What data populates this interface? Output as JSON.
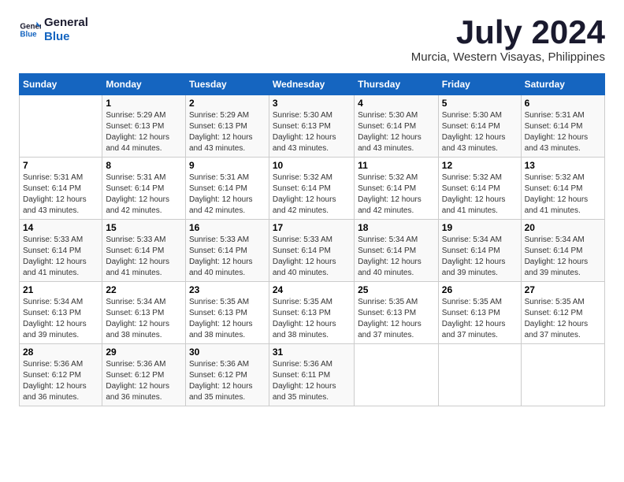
{
  "app": {
    "logo_line1": "General",
    "logo_line2": "Blue"
  },
  "header": {
    "month_year": "July 2024",
    "location": "Murcia, Western Visayas, Philippines"
  },
  "days_of_week": [
    "Sunday",
    "Monday",
    "Tuesday",
    "Wednesday",
    "Thursday",
    "Friday",
    "Saturday"
  ],
  "weeks": [
    [
      {
        "day": "",
        "sunrise": "",
        "sunset": "",
        "daylight": ""
      },
      {
        "day": "1",
        "sunrise": "Sunrise: 5:29 AM",
        "sunset": "Sunset: 6:13 PM",
        "daylight": "Daylight: 12 hours and 44 minutes."
      },
      {
        "day": "2",
        "sunrise": "Sunrise: 5:29 AM",
        "sunset": "Sunset: 6:13 PM",
        "daylight": "Daylight: 12 hours and 43 minutes."
      },
      {
        "day": "3",
        "sunrise": "Sunrise: 5:30 AM",
        "sunset": "Sunset: 6:13 PM",
        "daylight": "Daylight: 12 hours and 43 minutes."
      },
      {
        "day": "4",
        "sunrise": "Sunrise: 5:30 AM",
        "sunset": "Sunset: 6:14 PM",
        "daylight": "Daylight: 12 hours and 43 minutes."
      },
      {
        "day": "5",
        "sunrise": "Sunrise: 5:30 AM",
        "sunset": "Sunset: 6:14 PM",
        "daylight": "Daylight: 12 hours and 43 minutes."
      },
      {
        "day": "6",
        "sunrise": "Sunrise: 5:31 AM",
        "sunset": "Sunset: 6:14 PM",
        "daylight": "Daylight: 12 hours and 43 minutes."
      }
    ],
    [
      {
        "day": "7",
        "sunrise": "Sunrise: 5:31 AM",
        "sunset": "Sunset: 6:14 PM",
        "daylight": "Daylight: 12 hours and 43 minutes."
      },
      {
        "day": "8",
        "sunrise": "Sunrise: 5:31 AM",
        "sunset": "Sunset: 6:14 PM",
        "daylight": "Daylight: 12 hours and 42 minutes."
      },
      {
        "day": "9",
        "sunrise": "Sunrise: 5:31 AM",
        "sunset": "Sunset: 6:14 PM",
        "daylight": "Daylight: 12 hours and 42 minutes."
      },
      {
        "day": "10",
        "sunrise": "Sunrise: 5:32 AM",
        "sunset": "Sunset: 6:14 PM",
        "daylight": "Daylight: 12 hours and 42 minutes."
      },
      {
        "day": "11",
        "sunrise": "Sunrise: 5:32 AM",
        "sunset": "Sunset: 6:14 PM",
        "daylight": "Daylight: 12 hours and 42 minutes."
      },
      {
        "day": "12",
        "sunrise": "Sunrise: 5:32 AM",
        "sunset": "Sunset: 6:14 PM",
        "daylight": "Daylight: 12 hours and 41 minutes."
      },
      {
        "day": "13",
        "sunrise": "Sunrise: 5:32 AM",
        "sunset": "Sunset: 6:14 PM",
        "daylight": "Daylight: 12 hours and 41 minutes."
      }
    ],
    [
      {
        "day": "14",
        "sunrise": "Sunrise: 5:33 AM",
        "sunset": "Sunset: 6:14 PM",
        "daylight": "Daylight: 12 hours and 41 minutes."
      },
      {
        "day": "15",
        "sunrise": "Sunrise: 5:33 AM",
        "sunset": "Sunset: 6:14 PM",
        "daylight": "Daylight: 12 hours and 41 minutes."
      },
      {
        "day": "16",
        "sunrise": "Sunrise: 5:33 AM",
        "sunset": "Sunset: 6:14 PM",
        "daylight": "Daylight: 12 hours and 40 minutes."
      },
      {
        "day": "17",
        "sunrise": "Sunrise: 5:33 AM",
        "sunset": "Sunset: 6:14 PM",
        "daylight": "Daylight: 12 hours and 40 minutes."
      },
      {
        "day": "18",
        "sunrise": "Sunrise: 5:34 AM",
        "sunset": "Sunset: 6:14 PM",
        "daylight": "Daylight: 12 hours and 40 minutes."
      },
      {
        "day": "19",
        "sunrise": "Sunrise: 5:34 AM",
        "sunset": "Sunset: 6:14 PM",
        "daylight": "Daylight: 12 hours and 39 minutes."
      },
      {
        "day": "20",
        "sunrise": "Sunrise: 5:34 AM",
        "sunset": "Sunset: 6:14 PM",
        "daylight": "Daylight: 12 hours and 39 minutes."
      }
    ],
    [
      {
        "day": "21",
        "sunrise": "Sunrise: 5:34 AM",
        "sunset": "Sunset: 6:13 PM",
        "daylight": "Daylight: 12 hours and 39 minutes."
      },
      {
        "day": "22",
        "sunrise": "Sunrise: 5:34 AM",
        "sunset": "Sunset: 6:13 PM",
        "daylight": "Daylight: 12 hours and 38 minutes."
      },
      {
        "day": "23",
        "sunrise": "Sunrise: 5:35 AM",
        "sunset": "Sunset: 6:13 PM",
        "daylight": "Daylight: 12 hours and 38 minutes."
      },
      {
        "day": "24",
        "sunrise": "Sunrise: 5:35 AM",
        "sunset": "Sunset: 6:13 PM",
        "daylight": "Daylight: 12 hours and 38 minutes."
      },
      {
        "day": "25",
        "sunrise": "Sunrise: 5:35 AM",
        "sunset": "Sunset: 6:13 PM",
        "daylight": "Daylight: 12 hours and 37 minutes."
      },
      {
        "day": "26",
        "sunrise": "Sunrise: 5:35 AM",
        "sunset": "Sunset: 6:13 PM",
        "daylight": "Daylight: 12 hours and 37 minutes."
      },
      {
        "day": "27",
        "sunrise": "Sunrise: 5:35 AM",
        "sunset": "Sunset: 6:12 PM",
        "daylight": "Daylight: 12 hours and 37 minutes."
      }
    ],
    [
      {
        "day": "28",
        "sunrise": "Sunrise: 5:36 AM",
        "sunset": "Sunset: 6:12 PM",
        "daylight": "Daylight: 12 hours and 36 minutes."
      },
      {
        "day": "29",
        "sunrise": "Sunrise: 5:36 AM",
        "sunset": "Sunset: 6:12 PM",
        "daylight": "Daylight: 12 hours and 36 minutes."
      },
      {
        "day": "30",
        "sunrise": "Sunrise: 5:36 AM",
        "sunset": "Sunset: 6:12 PM",
        "daylight": "Daylight: 12 hours and 35 minutes."
      },
      {
        "day": "31",
        "sunrise": "Sunrise: 5:36 AM",
        "sunset": "Sunset: 6:11 PM",
        "daylight": "Daylight: 12 hours and 35 minutes."
      },
      {
        "day": "",
        "sunrise": "",
        "sunset": "",
        "daylight": ""
      },
      {
        "day": "",
        "sunrise": "",
        "sunset": "",
        "daylight": ""
      },
      {
        "day": "",
        "sunrise": "",
        "sunset": "",
        "daylight": ""
      }
    ]
  ]
}
